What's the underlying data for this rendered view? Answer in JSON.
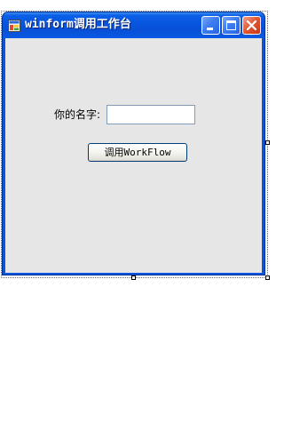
{
  "window": {
    "title": "winform调用工作台"
  },
  "form": {
    "name_label": "你的名字:",
    "name_input_value": "",
    "invoke_button_label": "调用WorkFlow"
  },
  "icons": {
    "app": "app-window-icon",
    "minimize": "minimize-icon",
    "maximize": "maximize-icon",
    "close": "close-icon"
  },
  "colors": {
    "titlebar": "#0855dd",
    "client_background": "#e6e6e6",
    "close_button": "#e2552f"
  }
}
